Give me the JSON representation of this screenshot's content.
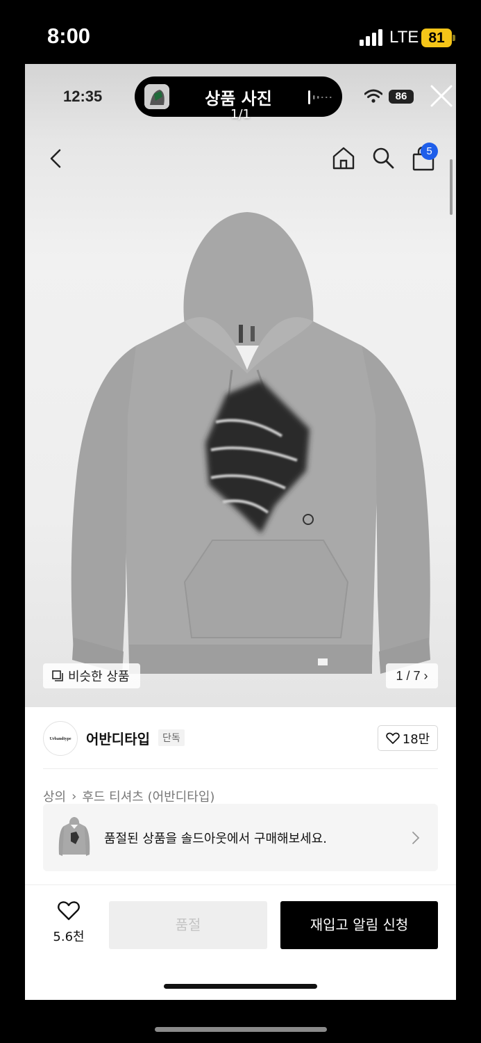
{
  "outer_status": {
    "time": "8:00",
    "network": "LTE",
    "battery": "81"
  },
  "inner_status": {
    "time": "12:35",
    "battery": "86"
  },
  "viewer": {
    "title": "상품 사진",
    "counter": "1/1"
  },
  "nav": {
    "cart_badge": "5"
  },
  "gallery": {
    "similar_label": "비슷한 상품",
    "page_counter": "1 / 7"
  },
  "brand": {
    "logo_text": "Urbandtype",
    "name": "어반디타입",
    "tag": "단독",
    "likes": "18만"
  },
  "breadcrumb": {
    "items": [
      "상의",
      "후드 티셔츠 (어반디타입)"
    ]
  },
  "soldout_banner": {
    "text": "품절된 상품을 솔드아웃에서 구매해보세요."
  },
  "bottom_bar": {
    "wish_count": "5.6천",
    "soldout_label": "품절",
    "restock_label": "재입고 알림 신청"
  },
  "colors": {
    "badge_blue": "#1e5eea",
    "outer_battery": "#f5c518",
    "restock_button": "#000000",
    "soldout_button": "#eeeeee"
  }
}
